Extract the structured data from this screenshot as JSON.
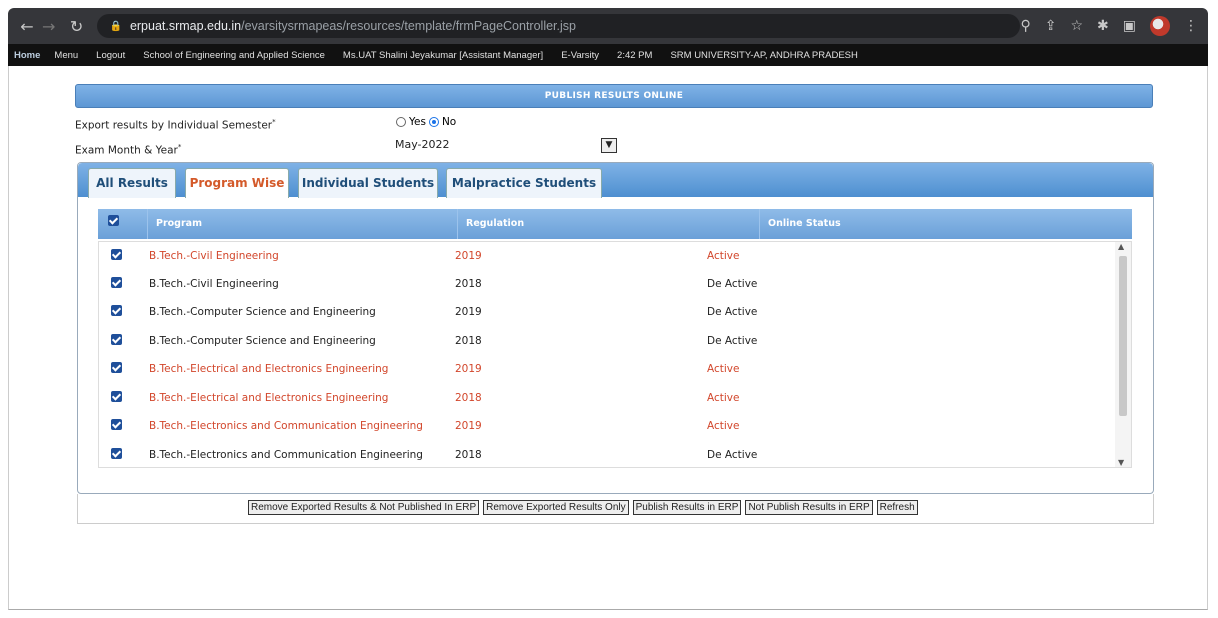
{
  "browser": {
    "url_host": "erpuat.srmap.edu.in",
    "url_path": "/evarsitysrmapeas/resources/template/frmPageController.jsp"
  },
  "menubar": {
    "items": [
      "Home",
      "Menu",
      "Logout",
      "School of Engineering and Applied Science",
      "Ms.UAT Shalini Jeyakumar [Assistant Manager]",
      "E-Varsity",
      "2:42 PM",
      "SRM UNIVERSITY-AP, ANDHRA PRADESH"
    ]
  },
  "section_title": "PUBLISH RESULTS ONLINE",
  "form": {
    "export_label": "Export results by Individual Semester",
    "export_required": "*",
    "radio_yes": "Yes",
    "radio_no": "No",
    "radio_selected": "No",
    "exam_label": "Exam Month & Year",
    "exam_required": "*",
    "exam_value": "May-2022"
  },
  "tabs": [
    "All Results",
    "Program Wise",
    "Individual Students",
    "Malpractice Students"
  ],
  "active_tab": "Program Wise",
  "grid": {
    "headers": [
      "Program",
      "Regulation",
      "Online Status"
    ],
    "rows": [
      {
        "program": "B.Tech.-Civil Engineering",
        "regulation": "2019",
        "status": "Active",
        "checked": true
      },
      {
        "program": "B.Tech.-Civil Engineering",
        "regulation": "2018",
        "status": "De Active",
        "checked": true
      },
      {
        "program": "B.Tech.-Computer Science and Engineering",
        "regulation": "2019",
        "status": "De Active",
        "checked": true
      },
      {
        "program": "B.Tech.-Computer Science and Engineering",
        "regulation": "2018",
        "status": "De Active",
        "checked": true
      },
      {
        "program": "B.Tech.-Electrical and Electronics Engineering",
        "regulation": "2019",
        "status": "Active",
        "checked": true
      },
      {
        "program": "B.Tech.-Electrical and Electronics Engineering",
        "regulation": "2018",
        "status": "Active",
        "checked": true
      },
      {
        "program": "B.Tech.-Electronics and Communication Engineering",
        "regulation": "2019",
        "status": "Active",
        "checked": true
      },
      {
        "program": "B.Tech.-Electronics and Communication Engineering",
        "regulation": "2018",
        "status": "De Active",
        "checked": true
      }
    ]
  },
  "buttons": [
    "Remove Exported Results & Not Published In ERP",
    "Remove Exported Results Only",
    "Publish Results in ERP",
    "Not Publish Results in ERP",
    "Refresh"
  ],
  "colors": {
    "active_row": "#d2462b",
    "header_blue": "#5d97d4",
    "active_tab_text": "#d45a2a"
  }
}
